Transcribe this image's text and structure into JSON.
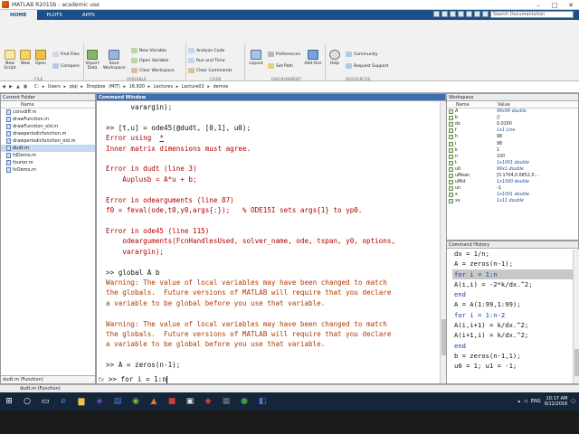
{
  "window_title": "MATLAB R2015b - academic use",
  "tabs": [
    "HOME",
    "PLOTS",
    "APPS"
  ],
  "search_placeholder": "Search Documentation",
  "ribbon": {
    "buttons": [
      "New Script",
      "New",
      "Open",
      "Import Data",
      "Save Workspace",
      "Layout",
      "Add-Ons",
      "Help"
    ],
    "small": [
      "Find Files",
      "Compare",
      "New Variable",
      "Open Variable",
      "Clear Workspace",
      "Analyze Code",
      "Run and Time",
      "Clear Commands",
      "Preferences",
      "Set Path",
      "Community",
      "Request Support"
    ],
    "groups": [
      "FILE",
      "VARIABLE",
      "CODE",
      "ENVIRONMENT",
      "RESOURCES"
    ]
  },
  "address": {
    "parts": [
      "C:",
      "Users",
      "qiqi",
      "Dropbox (MIT)",
      "16.920",
      "Lectures",
      "Lecture02",
      "demos"
    ]
  },
  "current_folder": {
    "title": "Current Folder",
    "col_name": "Name",
    "files": [
      "convdiff.m",
      "drawFunction.m",
      "drawFunction_old.m",
      "drawperiodicfunction.m",
      "drawperiodicfunction_old.m",
      "dudt.m",
      "fdDemo.m",
      "fourier.m",
      "fvDemo.m"
    ],
    "selected_index": 5,
    "footer": "dudt.m (Function)"
  },
  "command_window": {
    "title": "Command Window",
    "lines": [
      {
        "t": "      varargin);",
        "c": ""
      },
      {
        "t": "",
        "c": ""
      },
      {
        "t": ">> [t,u] = ode45(@dudt, [0,1], u0);",
        "c": ""
      },
      {
        "t": "Error using  *",
        "c": "red"
      },
      {
        "t": "Inner matrix dimensions must agree.",
        "c": "red"
      },
      {
        "t": "",
        "c": ""
      },
      {
        "t": "Error in dudt (line 3)",
        "c": "red"
      },
      {
        "t": "    Auplusb = A*u + b;",
        "c": "red"
      },
      {
        "t": "",
        "c": ""
      },
      {
        "t": "Error in odearguments (line 87)",
        "c": "red"
      },
      {
        "t": "f0 = feval(ode,t0,y0,args{:});   % ODE15I sets args{1} to yp0.",
        "c": "red"
      },
      {
        "t": "",
        "c": ""
      },
      {
        "t": "Error in ode45 (line 115)",
        "c": "red"
      },
      {
        "t": "    odearguments(FcnHandlesUsed, solver_name, ode, tspan, y0, options,",
        "c": "red"
      },
      {
        "t": "    varargin);",
        "c": "red"
      },
      {
        "t": "",
        "c": ""
      },
      {
        "t": ">> global A b",
        "c": ""
      },
      {
        "t": "Warning: The value of local variables may have been changed to match",
        "c": "warn"
      },
      {
        "t": "the globals.  Future versions of MATLAB will require that you declare",
        "c": "warn"
      },
      {
        "t": "a variable to be global before you use that variable.",
        "c": "warn"
      },
      {
        "t": "",
        "c": ""
      },
      {
        "t": "Warning: The value of local variables may have been changed to match",
        "c": "warn"
      },
      {
        "t": "the globals.  Future versions of MATLAB will require that you declare",
        "c": "warn"
      },
      {
        "t": "a variable to be global before you use that variable.",
        "c": "warn"
      },
      {
        "t": "",
        "c": ""
      },
      {
        "t": ">> A = zeros(n-1);",
        "c": ""
      }
    ],
    "prompt": "fx",
    "input": ">> for i = 1:n"
  },
  "workspace": {
    "title": "Workspace",
    "col_name": "Name",
    "col_value": "Value",
    "vars": [
      {
        "name": "A",
        "value": "99x99 double",
        "blue": true
      },
      {
        "name": "b",
        "value": "[]",
        "blue": true
      },
      {
        "name": "dx",
        "value": "0.0100",
        "blue": false
      },
      {
        "name": "f",
        "value": "1x1 Line",
        "blue": true
      },
      {
        "name": "h",
        "value": "98",
        "blue": false
      },
      {
        "name": "i",
        "value": "98",
        "blue": false
      },
      {
        "name": "k",
        "value": "1",
        "blue": false
      },
      {
        "name": "n",
        "value": "100",
        "blue": false
      },
      {
        "name": "t",
        "value": "1x1001 double",
        "blue": true
      },
      {
        "name": "u0",
        "value": "99x1 double",
        "blue": true
      },
      {
        "name": "uMean",
        "value": "[0.1704,0.6852,0...",
        "blue": false
      },
      {
        "name": "uMid",
        "value": "1x1000 double",
        "blue": true
      },
      {
        "name": "un",
        "value": "-1",
        "blue": false
      },
      {
        "name": "x",
        "value": "1x1001 double",
        "blue": true
      },
      {
        "name": "xx",
        "value": "1x11 double",
        "blue": true
      }
    ]
  },
  "history": {
    "title": "Command History",
    "lines": [
      {
        "t": "dx = 1/n;",
        "k": false,
        "hl": false
      },
      {
        "t": "A = zeros(n-1);",
        "k": false,
        "hl": false
      },
      {
        "t": "for i = 1:n",
        "k": true,
        "hl": true
      },
      {
        "t": "A(i,i) = -2*k/dx.^2;",
        "k": false,
        "hl": false
      },
      {
        "t": "end",
        "k": true,
        "hl": false
      },
      {
        "t": "A = A(1:99,1:99);",
        "k": false,
        "hl": false
      },
      {
        "t": "for i = 1:n-2",
        "k": true,
        "hl": false
      },
      {
        "t": "A(i,i+1) = k/dx.^2;",
        "k": false,
        "hl": false
      },
      {
        "t": "A(i+1,i) = k/dx.^2;",
        "k": false,
        "hl": false
      },
      {
        "t": "end",
        "k": true,
        "hl": false
      },
      {
        "t": "b = zeros(n-1,1);",
        "k": false,
        "hl": false
      },
      {
        "t": "u0 = 1; u1 = -1;",
        "k": false,
        "hl": false
      }
    ]
  },
  "clock": {
    "time": "10:17 AM",
    "date": "9/12/2016"
  },
  "tray_lang": "ENG"
}
